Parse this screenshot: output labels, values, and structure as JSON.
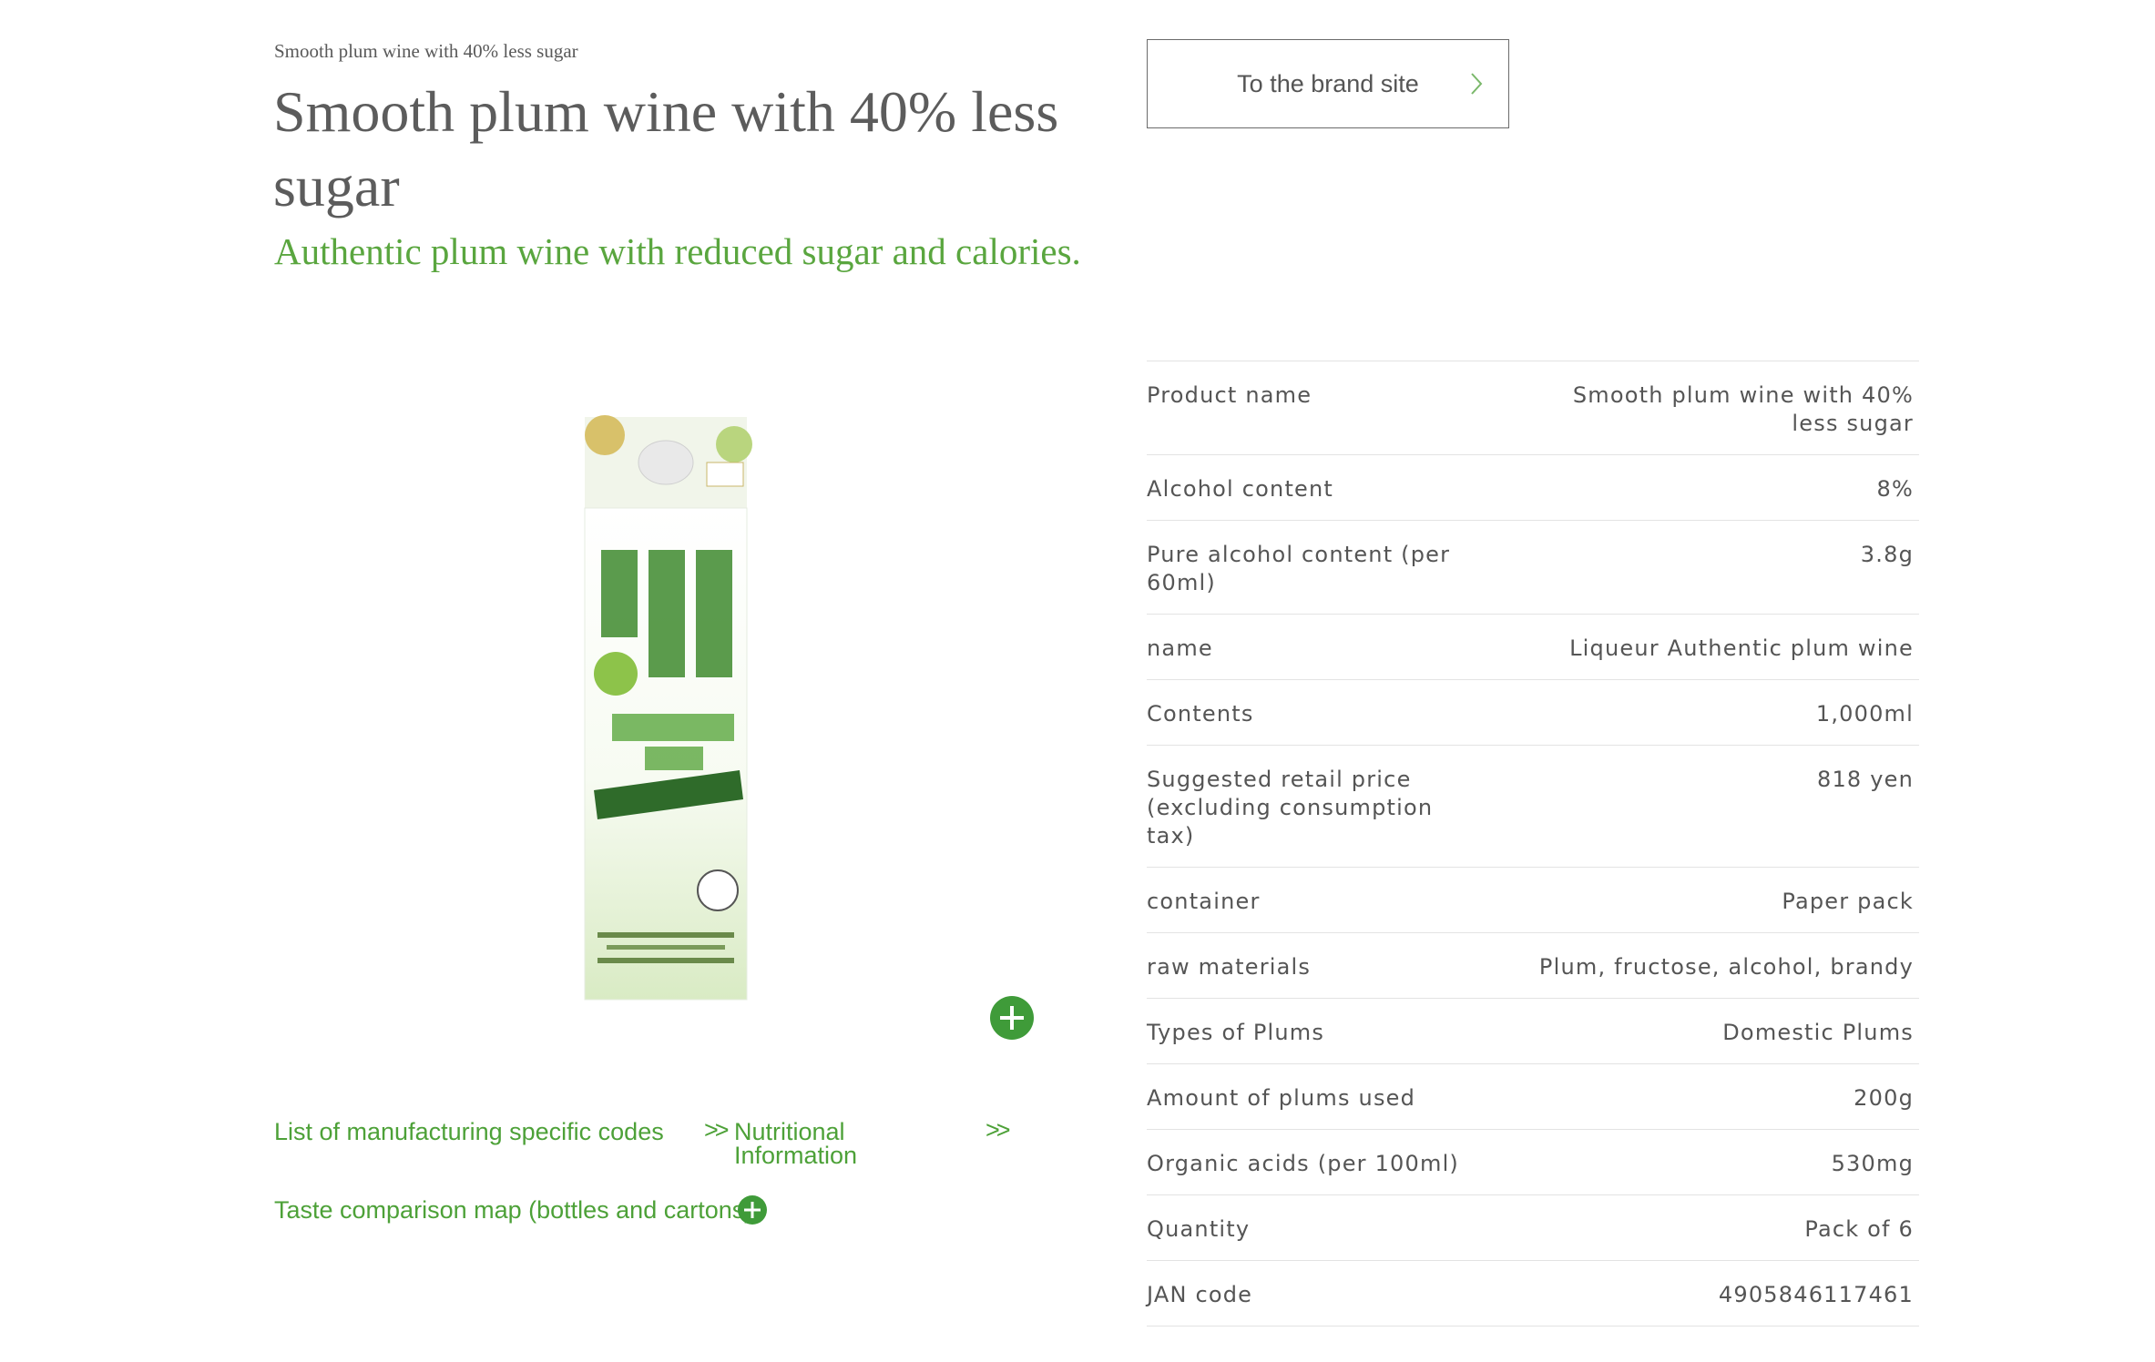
{
  "breadcrumb": "Smooth plum wine with 40% less sugar",
  "title": "Smooth plum wine with 40% less sugar",
  "tagline": "Authentic plum wine with reduced sugar and calories.",
  "brand_button": {
    "label": "To the brand site"
  },
  "product_image": {
    "alt": "CHOYA plum wine paper pack"
  },
  "links": {
    "codes": "List of manufacturing specific codes",
    "codes_arrow": ">>",
    "nutrition": "Nutritional Information",
    "nutrition_arrow": ">>",
    "taste": "Taste comparison map (bottles and cartons)"
  },
  "specs": [
    {
      "label": "Product name",
      "value": "Smooth plum wine with 40% less sugar"
    },
    {
      "label": "Alcohol content",
      "value": "8%"
    },
    {
      "label": "Pure alcohol content (per 60ml)",
      "value": "3.8g"
    },
    {
      "label": "name",
      "value": "Liqueur Authentic plum wine"
    },
    {
      "label": "Contents",
      "value": "1,000ml"
    },
    {
      "label": "Suggested retail price (excluding consumption tax)",
      "value": "818 yen"
    },
    {
      "label": "container",
      "value": "Paper pack"
    },
    {
      "label": "raw materials",
      "value": "Plum, fructose, alcohol, brandy"
    },
    {
      "label": "Types of Plums",
      "value": "Domestic Plums"
    },
    {
      "label": "Amount of plums used",
      "value": "200g"
    },
    {
      "label": "Organic acids (per 100ml)",
      "value": "530mg"
    },
    {
      "label": "Quantity",
      "value": "Pack of 6"
    },
    {
      "label": "JAN code",
      "value": "4905846117461"
    }
  ],
  "colors": {
    "accent": "#4da138",
    "text": "#555555"
  }
}
